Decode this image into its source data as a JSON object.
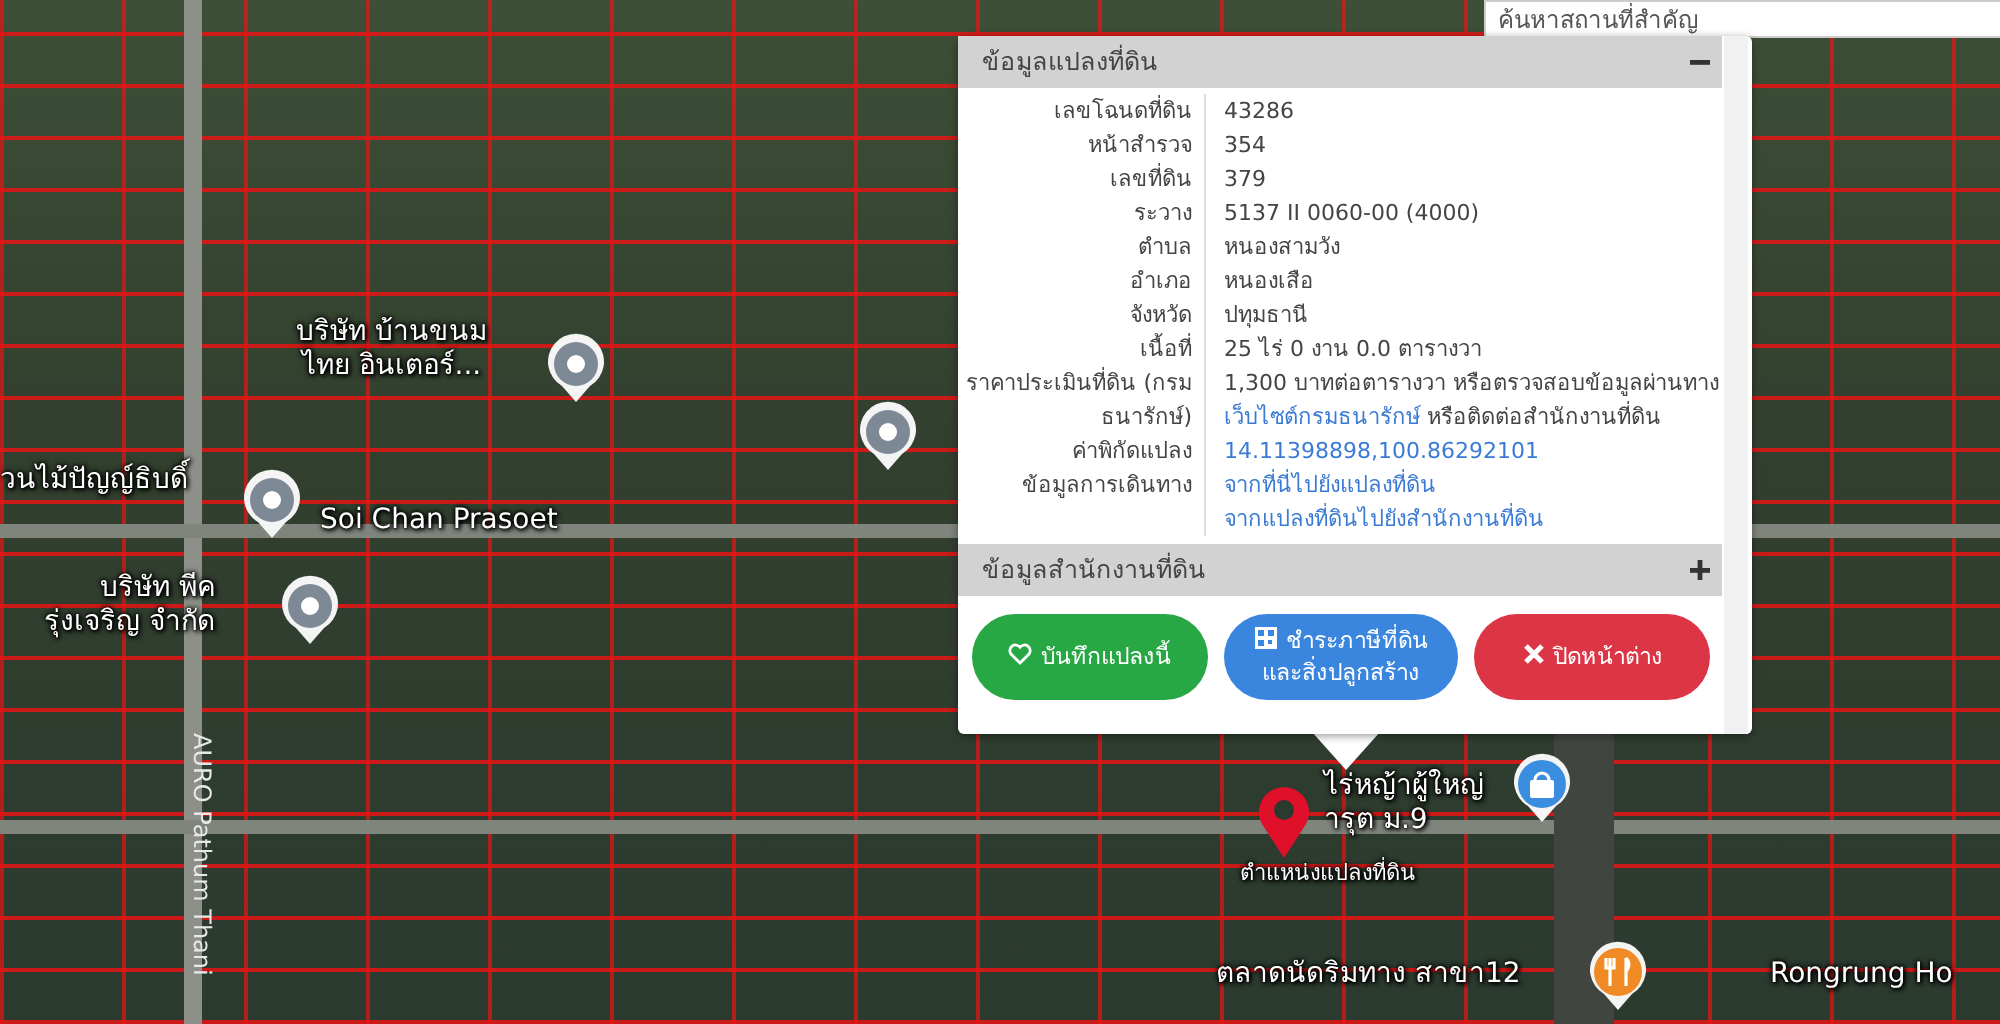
{
  "search": {
    "placeholder": "ค้นหาสถานที่สำคัญ"
  },
  "map_labels": [
    {
      "lines": [
        "บริษัท บ้านขนม",
        "ไทย อินเตอร์..."
      ]
    },
    {
      "lines": [
        "วนไม้ปัญญ์ธิบดิ์"
      ]
    },
    {
      "lines": [
        "Soi Chan Prasoet"
      ]
    },
    {
      "lines": [
        "บริษัท พีค",
        "รุ่งเจริญ จำกัด"
      ]
    },
    {
      "lines": [
        "ไร่หญ้าผู้ใหญ่",
        "ารุต ม.9"
      ]
    },
    {
      "lines": [
        "ตำแหน่งแปลงที่ดิน"
      ]
    },
    {
      "lines": [
        "ตลาดนัดริมทาง สาขา12"
      ]
    },
    {
      "lines": [
        "Rongrung Ho"
      ]
    },
    {
      "lines": [
        "AURO Pathum Thani"
      ]
    }
  ],
  "pins": [
    {
      "kind": "place"
    },
    {
      "kind": "place"
    },
    {
      "kind": "place"
    },
    {
      "kind": "place"
    },
    {
      "kind": "parcel"
    },
    {
      "kind": "shop"
    },
    {
      "kind": "food"
    }
  ],
  "popup": {
    "sections": [
      {
        "title": "ข้อมูลแปลงที่ดิน",
        "expanded": true,
        "rows": [
          {
            "label": "เลขโฉนดที่ดิน",
            "values": [
              {
                "kind": "text",
                "text": "43286"
              }
            ]
          },
          {
            "label": "หน้าสำรวจ",
            "values": [
              {
                "kind": "text",
                "text": "354"
              }
            ]
          },
          {
            "label": "เลขที่ดิน",
            "values": [
              {
                "kind": "text",
                "text": "379"
              }
            ]
          },
          {
            "label": "ระวาง",
            "values": [
              {
                "kind": "text",
                "text": "5137 II 0060-00 (4000)"
              }
            ]
          },
          {
            "label": "ตำบล",
            "values": [
              {
                "kind": "text",
                "text": "หนองสามวัง"
              }
            ]
          },
          {
            "label": "อำเภอ",
            "values": [
              {
                "kind": "text",
                "text": "หนองเสือ"
              }
            ]
          },
          {
            "label": "จังหวัด",
            "values": [
              {
                "kind": "text",
                "text": "ปทุมธานี"
              }
            ]
          },
          {
            "label": "เนื้อที่",
            "values": [
              {
                "kind": "text",
                "text": "25 ไร่ 0 งาน 0.0 ตารางวา"
              }
            ]
          },
          {
            "label": "ราคาประเมินที่ดิน (กรมธนารักษ์)",
            "values": [
              {
                "kind": "sentence",
                "before": "1,300 บาทต่อตารางวา หรือตรวจสอบข้อมูลผ่านทาง",
                "link": "เว็บไซต์กรมธนารักษ์",
                "after": "หรือติดต่อสำนักงานที่ดิน"
              }
            ]
          },
          {
            "label": "ค่าพิกัดแปลง",
            "values": [
              {
                "kind": "link",
                "text": "14.11398898,100.86292101"
              }
            ]
          },
          {
            "label": "ข้อมูลการเดินทาง",
            "values": [
              {
                "kind": "link",
                "text": "จากที่นี่ไปยังแปลงที่ดิน"
              },
              {
                "kind": "link",
                "text": "จากแปลงที่ดินไปยังสำนักงานที่ดิน"
              }
            ]
          }
        ]
      },
      {
        "title": "ข้อมูลสำนักงานที่ดิน",
        "expanded": false
      }
    ],
    "buttons": [
      {
        "kind": "save",
        "label": "บันทึกแปลงนี้"
      },
      {
        "kind": "pay",
        "label": "ชำระภาษีที่ดินและสิ่งปลูกสร้าง"
      },
      {
        "kind": "close",
        "label": "ปิดหน้าต่าง"
      }
    ]
  }
}
